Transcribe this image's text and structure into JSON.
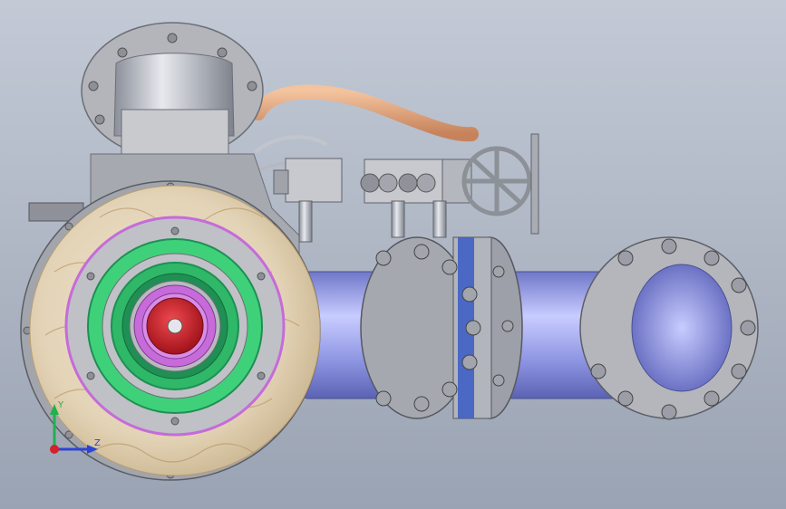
{
  "viewport": {
    "background_top": "#c3cad6",
    "background_bottom": "#9aa3b3"
  },
  "model": {
    "pipe_color": "#9aa0e6",
    "flange_color": "#a9a9b3",
    "insulation_color": "#e9dcc6",
    "ring_magenta": "#c66bd9",
    "ring_green": "#3fd17a",
    "ring_dark_green": "#1f8f54",
    "core_red": "#d21f2a",
    "hose_color": "#e0a37a",
    "handwheel_color": "#b9bcc2"
  },
  "triad": {
    "y_label": "Y",
    "z_label": "Z",
    "y_color": "#22b14c",
    "z_color": "#2b45d6",
    "x_color": "#d2222d"
  }
}
